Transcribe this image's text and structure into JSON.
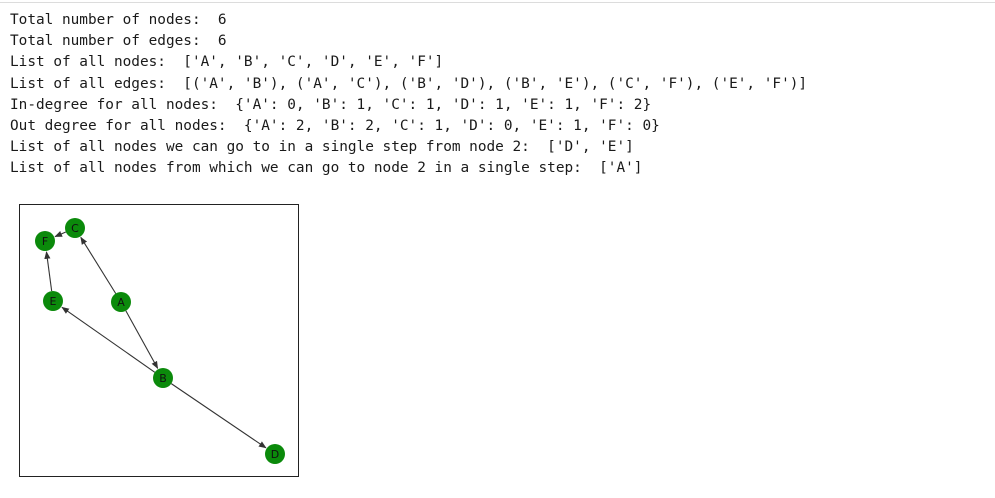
{
  "output": {
    "lines": [
      "Total number of nodes:  6",
      "Total number of edges:  6",
      "List of all nodes:  ['A', 'B', 'C', 'D', 'E', 'F']",
      "List of all edges:  [('A', 'B'), ('A', 'C'), ('B', 'D'), ('B', 'E'), ('C', 'F'), ('E', 'F')]",
      "In-degree for all nodes:  {'A': 0, 'B': 1, 'C': 1, 'D': 1, 'E': 1, 'F': 2}",
      "Out degree for all nodes:  {'A': 2, 'B': 2, 'C': 1, 'D': 0, 'E': 1, 'F': 0}",
      "List of all nodes we can go to in a single step from node 2:  ['D', 'E']",
      "List of all nodes from which we can go to node 2 in a single step:  ['A']"
    ]
  },
  "graph": {
    "node_color": "#0b8a0b",
    "edge_color": "#333333",
    "nodes": [
      {
        "id": "A",
        "label": "A"
      },
      {
        "id": "B",
        "label": "B"
      },
      {
        "id": "C",
        "label": "C"
      },
      {
        "id": "D",
        "label": "D"
      },
      {
        "id": "E",
        "label": "E"
      },
      {
        "id": "F",
        "label": "F"
      }
    ],
    "edges": [
      [
        "A",
        "B"
      ],
      [
        "A",
        "C"
      ],
      [
        "B",
        "D"
      ],
      [
        "B",
        "E"
      ],
      [
        "C",
        "F"
      ],
      [
        "E",
        "F"
      ]
    ]
  }
}
